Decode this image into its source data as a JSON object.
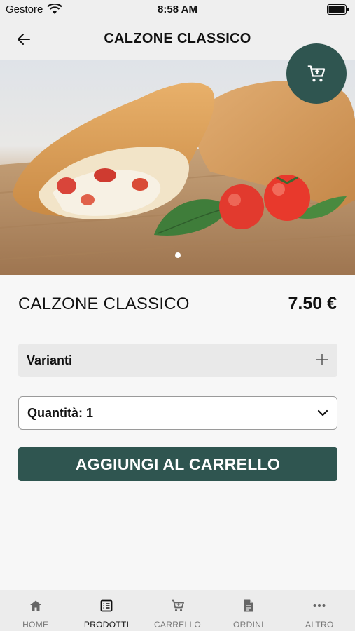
{
  "status_bar": {
    "carrier": "Gestore",
    "time": "8:58 AM"
  },
  "header": {
    "title": "CALZONE CLASSICO"
  },
  "product": {
    "name": "CALZONE CLASSICO",
    "price": "7.50 €"
  },
  "variants": {
    "label": "Varianti"
  },
  "quantity": {
    "label": "Quantità: 1"
  },
  "add_to_cart": {
    "label": "AGGIUNGI AL CARRELLO"
  },
  "tabs": [
    {
      "label": "HOME",
      "icon": "home-icon"
    },
    {
      "label": "PRODOTTI",
      "icon": "list-icon",
      "active": true
    },
    {
      "label": "CARRELLO",
      "icon": "cart-icon"
    },
    {
      "label": "ORDINI",
      "icon": "document-icon"
    },
    {
      "label": "ALTRO",
      "icon": "more-icon"
    }
  ],
  "colors": {
    "accent": "#2f5550",
    "background": "#f7f7f7",
    "tab_bar": "#ececec"
  }
}
